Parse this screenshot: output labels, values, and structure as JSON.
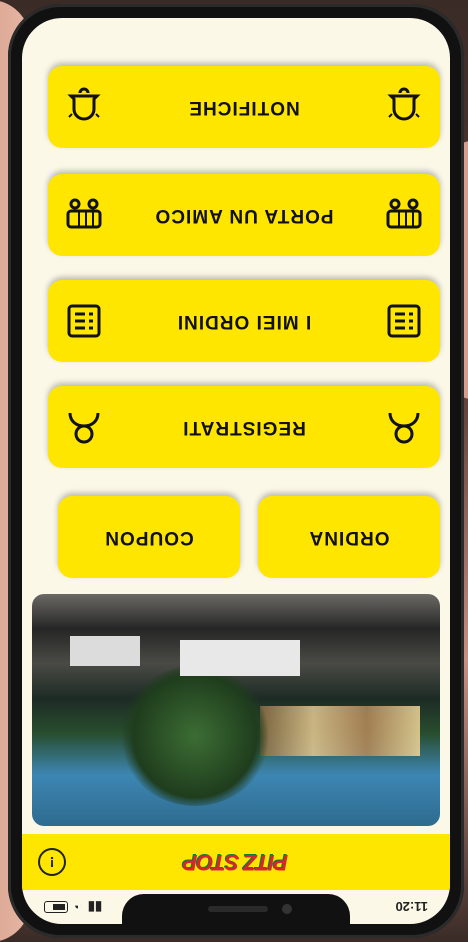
{
  "status": {
    "time": "11:20",
    "carrier_icon": "signal-icon",
    "wifi_icon": "wifi-icon",
    "battery_icon": "battery-icon"
  },
  "header": {
    "logo_text": "PITZ STOP",
    "info_icon": "info-icon"
  },
  "buttons": {
    "ordina": "ORDINA",
    "coupon": "COUPON",
    "registrati": "REGISTRATI",
    "ordini": "I MIEI ORDINI",
    "amico": "PORTA UN AMICO",
    "notifiche": "NOTIFICHE"
  },
  "colors": {
    "accent": "#ffe600",
    "background": "#fbf8e8",
    "text": "#111111"
  }
}
